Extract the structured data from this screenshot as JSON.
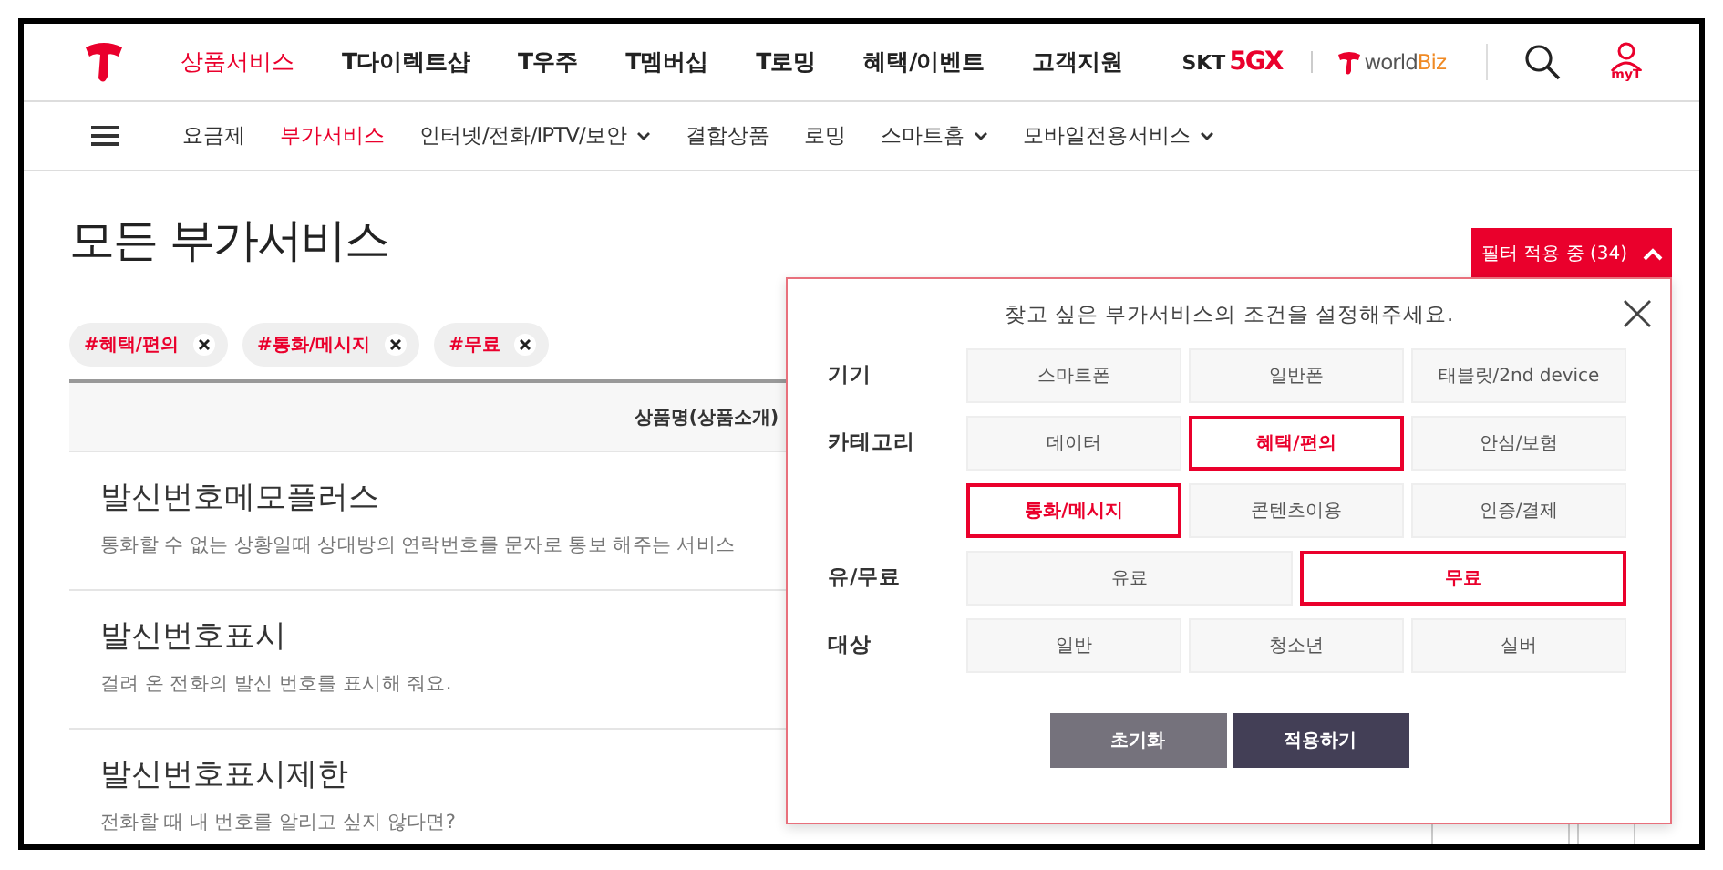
{
  "header": {
    "nav": [
      {
        "label": "상품서비스",
        "selected": true
      },
      {
        "label": "T다이렉트샵",
        "selected": false
      },
      {
        "label": "T우주",
        "selected": false
      },
      {
        "label": "T멤버십",
        "selected": false
      },
      {
        "label": "T로밍",
        "selected": false
      },
      {
        "label": "혜택/이벤트",
        "selected": false
      },
      {
        "label": "고객지원",
        "selected": false
      }
    ],
    "skt_label": "SKT",
    "fivegx_label": "5GX",
    "worldbiz": {
      "first": "world",
      "second": "Biz"
    },
    "myt_label": "myT"
  },
  "subnav": [
    {
      "label": "요금제",
      "selected": false,
      "dropdown": false
    },
    {
      "label": "부가서비스",
      "selected": true,
      "dropdown": false
    },
    {
      "label": "인터넷/전화/IPTV/보안",
      "selected": false,
      "dropdown": true
    },
    {
      "label": "결합상품",
      "selected": false,
      "dropdown": false
    },
    {
      "label": "로밍",
      "selected": false,
      "dropdown": false
    },
    {
      "label": "스마트홈",
      "selected": false,
      "dropdown": true
    },
    {
      "label": "모바일전용서비스",
      "selected": false,
      "dropdown": true
    }
  ],
  "title": "모든 부가서비스",
  "filter_button": {
    "label": "필터 적용 중 (34)",
    "expanded": true
  },
  "tags": [
    {
      "label": "#혜택/편의"
    },
    {
      "label": "#통화/메시지"
    },
    {
      "label": "#무료"
    }
  ],
  "table": {
    "column": "상품명(상품소개)",
    "rows": [
      {
        "name": "발신번호메모플러스",
        "description": "통화할 수 없는 상황일때 상대방의 연락번호를 문자로 통보 해주는 서비스"
      },
      {
        "name": "발신번호표시",
        "description": "걸려 온 전화의 발신 번호를 표시해 줘요."
      },
      {
        "name": "발신번호표시제한",
        "description": "전화할 때 내 번호를 알리고 싶지 않다면?"
      }
    ]
  },
  "filter_panel": {
    "prompt": "찾고 싶은 부가서비스의 조건을 설정해주세요.",
    "groups": [
      {
        "label": "기기",
        "options": [
          {
            "label": "스마트폰",
            "selected": false
          },
          {
            "label": "일반폰",
            "selected": false
          },
          {
            "label": "태블릿/2nd device",
            "selected": false
          }
        ]
      },
      {
        "label": "카테고리",
        "options": [
          {
            "label": "데이터",
            "selected": false
          },
          {
            "label": "혜택/편의",
            "selected": true
          },
          {
            "label": "안심/보험",
            "selected": false
          },
          {
            "label": "통화/메시지",
            "selected": true
          },
          {
            "label": "콘텐츠이용",
            "selected": false
          },
          {
            "label": "인증/결제",
            "selected": false
          }
        ]
      },
      {
        "label": "유/무료",
        "options": [
          {
            "label": "유료",
            "selected": false
          },
          {
            "label": "무료",
            "selected": true
          }
        ]
      },
      {
        "label": "대상",
        "options": [
          {
            "label": "일반",
            "selected": false
          },
          {
            "label": "청소년",
            "selected": false
          },
          {
            "label": "실버",
            "selected": false
          }
        ]
      }
    ],
    "buttons": [
      {
        "label": "초기화",
        "kind": "reset"
      },
      {
        "label": "적용하기",
        "kind": "apply"
      }
    ]
  }
}
